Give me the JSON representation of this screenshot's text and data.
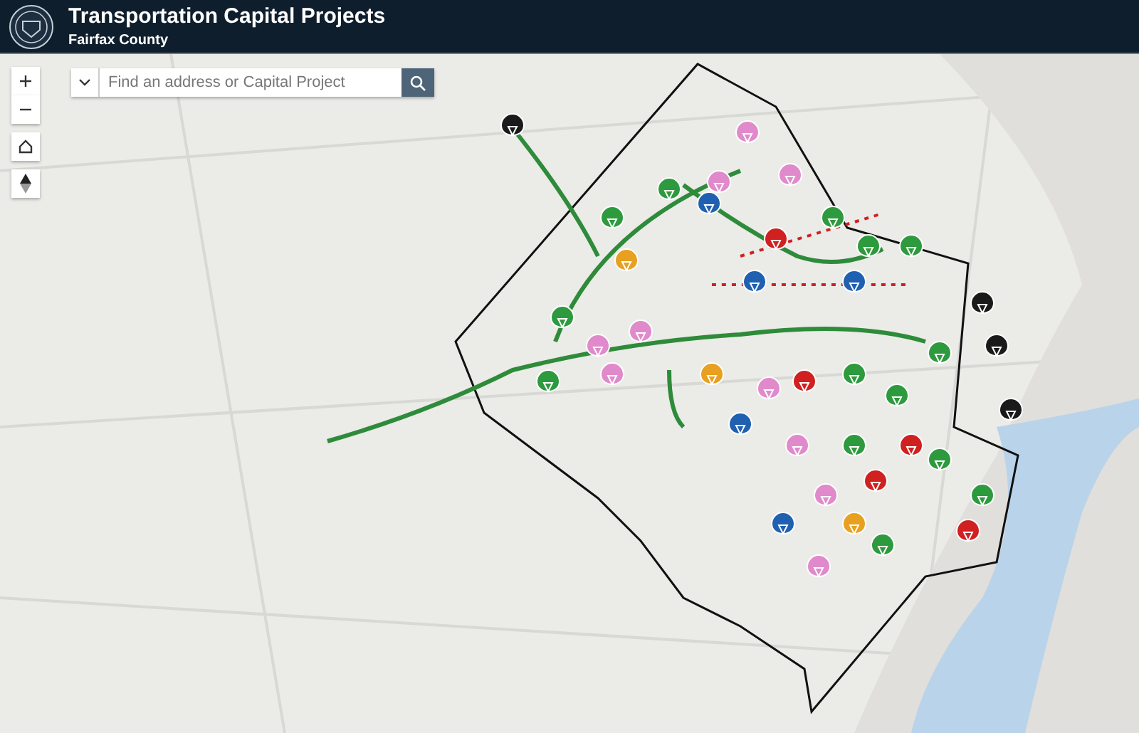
{
  "header": {
    "title": "Transportation Capital Projects",
    "subtitle": "Fairfax County"
  },
  "search": {
    "placeholder": "Find an address or Capital Project"
  }
}
